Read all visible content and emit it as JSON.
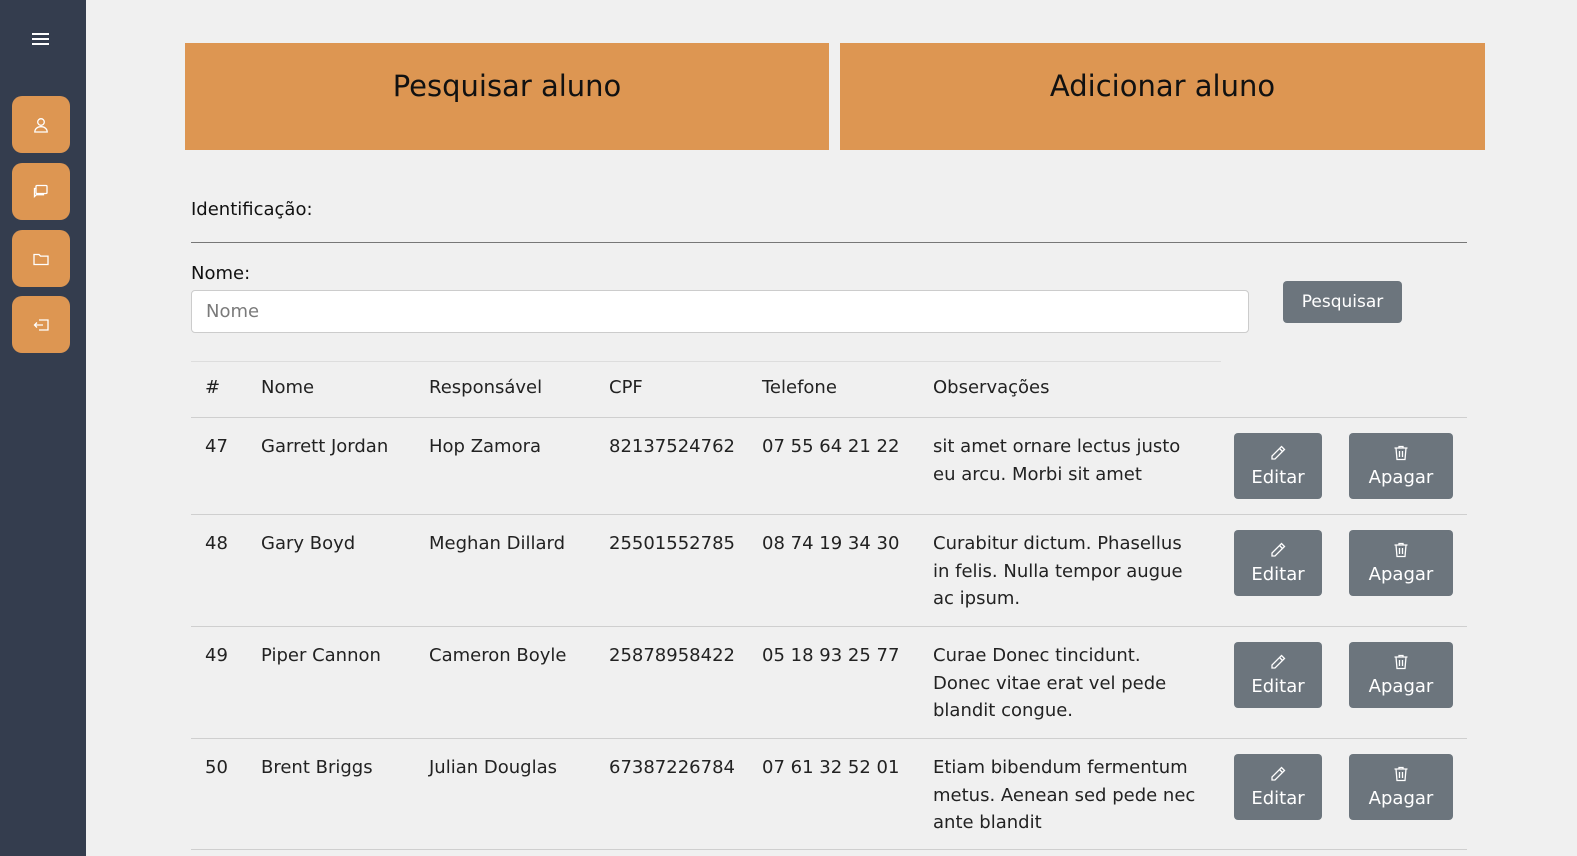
{
  "sidebar": {
    "menu_icon": "hamburger-icon",
    "items": [
      {
        "icon": "user-icon",
        "name": "sidebar-item-students"
      },
      {
        "icon": "chat-icon",
        "name": "sidebar-item-messages"
      },
      {
        "icon": "folder-icon",
        "name": "sidebar-item-files"
      },
      {
        "icon": "logout-icon",
        "name": "sidebar-item-logout"
      }
    ],
    "background": "#343d4e",
    "accent": "#dd9652"
  },
  "tabs": {
    "search": "Pesquisar aluno",
    "add": "Adicionar aluno"
  },
  "form": {
    "section_title": "Identificação:",
    "name_label": "Nome:",
    "name_placeholder": "Nome",
    "name_value": "",
    "search_button": "Pesquisar"
  },
  "table": {
    "headers": [
      "#",
      "Nome",
      "Responsável",
      "CPF",
      "Telefone",
      "Observações"
    ],
    "edit_label": "Editar",
    "delete_label": "Apagar",
    "rows": [
      {
        "id": "47",
        "nome": "Garrett Jordan",
        "responsavel": "Hop Zamora",
        "cpf": "82137524762",
        "telefone": "07 55 64 21 22",
        "obs_lines": [
          "sit amet ornare lectus justo",
          "eu arcu. Morbi sit amet"
        ]
      },
      {
        "id": "48",
        "nome": "Gary Boyd",
        "responsavel": "Meghan Dillard",
        "cpf": "25501552785",
        "telefone": "08 74 19 34 30",
        "obs_lines": [
          "Curabitur dictum. Phasellus",
          "in felis. Nulla tempor augue",
          "ac ipsum."
        ]
      },
      {
        "id": "49",
        "nome": "Piper Cannon",
        "responsavel": "Cameron Boyle",
        "cpf": "25878958422",
        "telefone": "05 18 93 25 77",
        "obs_lines": [
          "Curae Donec tincidunt.",
          "Donec vitae erat vel pede",
          "blandit congue."
        ]
      },
      {
        "id": "50",
        "nome": "Brent Briggs",
        "responsavel": "Julian Douglas",
        "cpf": "67387226784",
        "telefone": "07 61 32 52 01",
        "obs_lines": [
          "Etiam bibendum fermentum",
          "metus. Aenean sed pede nec",
          "ante blandit"
        ]
      }
    ]
  }
}
